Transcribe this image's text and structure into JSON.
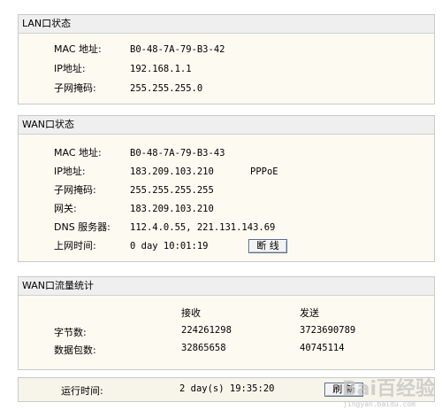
{
  "lan": {
    "title": "LAN口状态",
    "mac_label": "MAC 地址:",
    "mac_value": "B0-48-7A-79-B3-42",
    "ip_label": "IP地址:",
    "ip_value": "192.168.1.1",
    "mask_label": "子网掩码:",
    "mask_value": "255.255.255.0"
  },
  "wan": {
    "title": "WAN口状态",
    "mac_label": "MAC 地址:",
    "mac_value": "B0-48-7A-79-B3-43",
    "ip_label": "IP地址:",
    "ip_value": "183.209.103.210",
    "ip_type": "PPPoE",
    "mask_label": "子网掩码:",
    "mask_value": "255.255.255.255",
    "gateway_label": "网关:",
    "gateway_value": "183.209.103.210",
    "dns_label": "DNS 服务器:",
    "dns_value": "112.4.0.55, 221.131.143.69",
    "online_label": "上网时间:",
    "online_value": "0 day 10:01:19",
    "disconnect_label": "断 线"
  },
  "traffic": {
    "title": "WAN口流量统计",
    "col_recv": "接收",
    "col_send": "发送",
    "bytes_label": "字节数:",
    "bytes_recv": "224261298",
    "bytes_send": "3723690789",
    "packets_label": "数据包数:",
    "packets_recv": "32865658",
    "packets_send": "40745114"
  },
  "runtime": {
    "label": "运行时间:",
    "value": "2 day(s) 19:35:20",
    "refresh_label": "刷 新"
  },
  "watermark": {
    "text": "Bai百经验",
    "sub": "jingyan.baidu.com"
  }
}
